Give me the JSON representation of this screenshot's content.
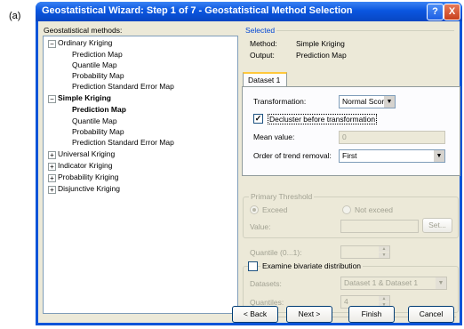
{
  "figure_label": "(a)",
  "window": {
    "title": "Geostatistical Wizard: Step 1 of 7 - Geostatistical Method Selection",
    "help_label": "?",
    "close_label": "X"
  },
  "methods": {
    "label": "Geostatistical methods:",
    "tree": [
      {
        "label": "Ordinary Kriging",
        "expanded": true,
        "children": [
          "Prediction Map",
          "Quantile Map",
          "Probability Map",
          "Prediction Standard Error Map"
        ]
      },
      {
        "label": "Simple Kriging",
        "expanded": true,
        "selected_child": "Prediction Map",
        "children": [
          "Prediction Map",
          "Quantile Map",
          "Probability Map",
          "Prediction Standard Error Map"
        ]
      },
      {
        "label": "Universal Kriging",
        "expanded": false
      },
      {
        "label": "Indicator Kriging",
        "expanded": false
      },
      {
        "label": "Probability Kriging",
        "expanded": false
      },
      {
        "label": "Disjunctive Kriging",
        "expanded": false
      }
    ]
  },
  "selected": {
    "title": "Selected",
    "method_label": "Method:",
    "method_value": "Simple Kriging",
    "output_label": "Output:",
    "output_value": "Prediction Map"
  },
  "dataset": {
    "tab_label": "Dataset 1",
    "transformation_label": "Transformation:",
    "transformation_value": "Normal Score",
    "decluster_label": "Decluster before transformation",
    "decluster_checked": true,
    "mean_label": "Mean value:",
    "mean_value": "0",
    "trend_label": "Order of trend removal:",
    "trend_value": "First"
  },
  "threshold": {
    "title": "Primary Threshold",
    "exceed_label": "Exceed",
    "not_exceed_label": "Not exceed",
    "value_label": "Value:",
    "set_label": "Set...",
    "quantile_label": "Quantile (0...1):"
  },
  "bivariate": {
    "label": "Examine bivariate distribution",
    "checked": false,
    "datasets_label": "Datasets:",
    "datasets_value": "Dataset 1 & Dataset 1",
    "quantiles_label": "Quantiles:",
    "quantiles_value": "4"
  },
  "footer": {
    "back_label": "< Back",
    "next_label": "Next >",
    "finish_label": "Finish",
    "cancel_label": "Cancel"
  }
}
